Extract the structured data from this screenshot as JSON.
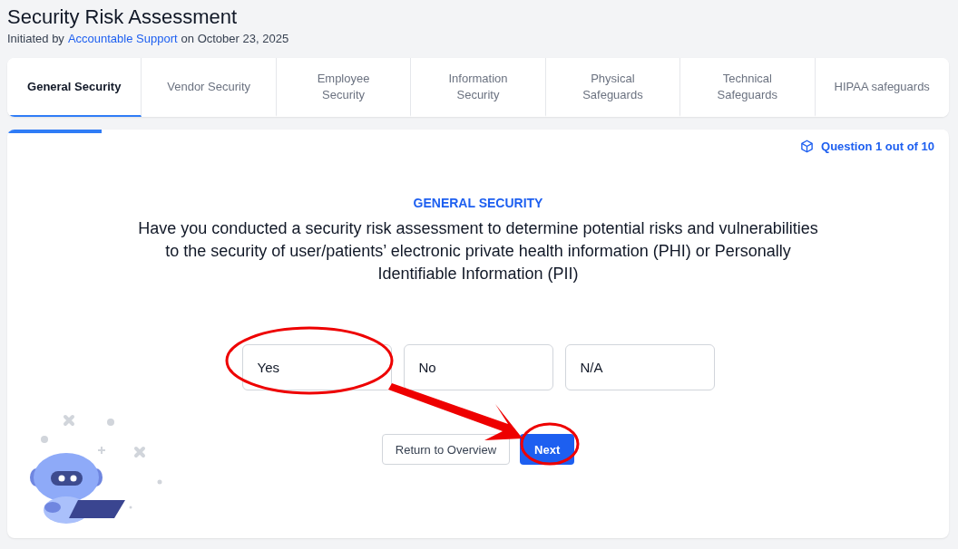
{
  "page": {
    "title": "Security Risk Assessment",
    "initiated_prefix": "Initiated by",
    "initiator": "Accountable Support",
    "initiated_suffix": "on October 23, 2025"
  },
  "tabs": [
    {
      "label": "General Security",
      "selected": true
    },
    {
      "label": "Vendor Security",
      "selected": false
    },
    {
      "label": "Employee Security",
      "selected": false
    },
    {
      "label": "Information Security",
      "selected": false
    },
    {
      "label": "Physical Safeguards",
      "selected": false
    },
    {
      "label": "Technical Safeguards",
      "selected": false
    },
    {
      "label": "HIPAA safeguards",
      "selected": false
    }
  ],
  "progress": {
    "level": 0.1,
    "counter": "Question 1 out of 10"
  },
  "question": {
    "section": "GENERAL SECURITY",
    "text": "Have you conducted a security risk assessment to determine potential risks and vulnerabilities to the security of user/patients’ electronic private health information (PHI) or Personally Identifiable Information (PII)"
  },
  "options": [
    {
      "label": "Yes",
      "selected": false
    },
    {
      "label": "No",
      "selected": false
    },
    {
      "label": "N/A",
      "selected": false
    }
  ],
  "buttons": {
    "back": "Return to Overview",
    "next": "Next"
  }
}
